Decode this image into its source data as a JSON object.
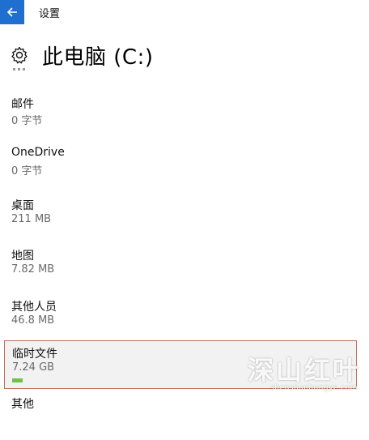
{
  "window": {
    "title": "设置",
    "back_icon": "back-arrow-icon"
  },
  "header": {
    "icon": "gear-icon",
    "title": "此电脑 (C:)"
  },
  "items": [
    {
      "name": "邮件",
      "size": "0 字节"
    },
    {
      "name": "OneDrive",
      "size": "0 字节"
    },
    {
      "name": "桌面",
      "size": "211 MB"
    },
    {
      "name": "地图",
      "size": "7.82 MB"
    },
    {
      "name": "其他人员",
      "size": "46.8 MB"
    },
    {
      "name": "临时文件",
      "size": "7.24 GB",
      "selected": true,
      "usage_fraction": 0.03
    },
    {
      "name": "其他",
      "size": ""
    }
  ],
  "watermark": {
    "main": "深山红叶",
    "sub": "shenshanhongye.com"
  },
  "colors": {
    "accent": "#1f6fd1",
    "selection_border": "#c26a5f",
    "usage_bar": "#6ec24a"
  }
}
